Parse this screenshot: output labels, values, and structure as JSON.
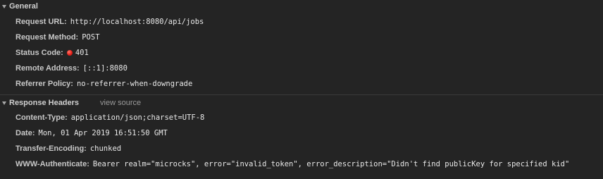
{
  "general": {
    "title": "General",
    "request_url": {
      "key": "Request URL:",
      "value": "http://localhost:8080/api/jobs"
    },
    "request_method": {
      "key": "Request Method:",
      "value": "POST"
    },
    "status_code": {
      "key": "Status Code:",
      "value": "401",
      "status_color": "#e8201a"
    },
    "remote_address": {
      "key": "Remote Address:",
      "value": "[::1]:8080"
    },
    "referrer_policy": {
      "key": "Referrer Policy:",
      "value": "no-referrer-when-downgrade"
    }
  },
  "response_headers": {
    "title": "Response Headers",
    "view_source": "view source",
    "items": [
      {
        "key": "Content-Type:",
        "value": "application/json;charset=UTF-8"
      },
      {
        "key": "Date:",
        "value": "Mon, 01 Apr 2019 16:51:50 GMT"
      },
      {
        "key": "Transfer-Encoding:",
        "value": "chunked"
      },
      {
        "key": "WWW-Authenticate:",
        "value": "Bearer realm=\"microcks\", error=\"invalid_token\", error_description=\"Didn't find publicKey for specified kid\""
      }
    ]
  }
}
